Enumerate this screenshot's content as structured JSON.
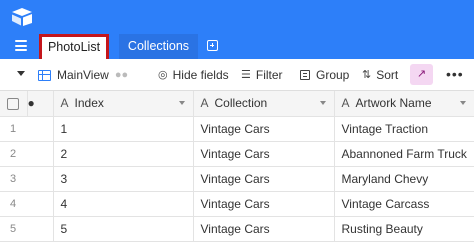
{
  "tabs": [
    {
      "label": "PhotoList",
      "active": true,
      "highlighted": true
    },
    {
      "label": "Collections",
      "active": false
    }
  ],
  "toolbar": {
    "view_name": "MainView",
    "hide_fields": "Hide fields",
    "filter": "Filter",
    "group": "Group",
    "sort": "Sort"
  },
  "columns": [
    {
      "label": "Index",
      "icon": "text-field-icon"
    },
    {
      "label": "Collection",
      "icon": "text-field-icon"
    },
    {
      "label": "Artwork Name",
      "icon": "text-field-icon"
    }
  ],
  "rows": [
    {
      "num": "1",
      "index": "1",
      "collection": "Vintage Cars",
      "artwork": "Vintage Traction"
    },
    {
      "num": "2",
      "index": "2",
      "collection": "Vintage Cars",
      "artwork": "Abannoned Farm Truck"
    },
    {
      "num": "3",
      "index": "3",
      "collection": "Vintage Cars",
      "artwork": "Maryland Chevy"
    },
    {
      "num": "4",
      "index": "4",
      "collection": "Vintage Cars",
      "artwork": "Vintage Carcass"
    },
    {
      "num": "5",
      "index": "5",
      "collection": "Vintage Cars",
      "artwork": "Rusting Beauty"
    }
  ],
  "colors": {
    "brand_blue": "#2d7ff9",
    "highlight_red": "#c4161c",
    "share_pink": "#f4d7f2"
  }
}
